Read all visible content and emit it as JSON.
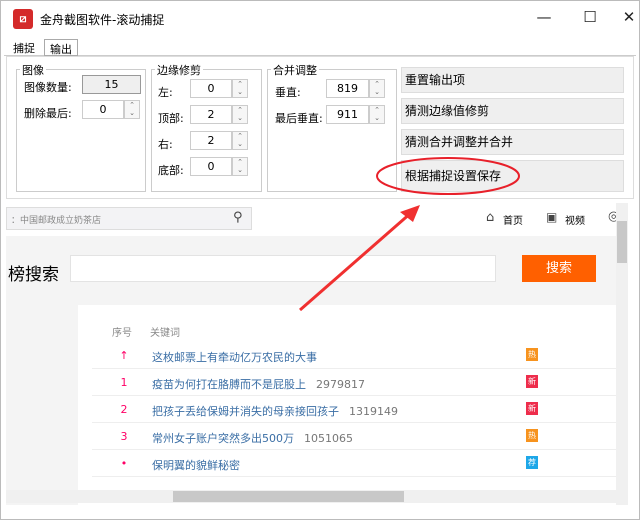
{
  "window": {
    "title": "金舟截图软件-滚动捕捉",
    "app_icon": "ZJ"
  },
  "tabs": [
    {
      "label": "捕捉"
    },
    {
      "label": "输出"
    }
  ],
  "groups": {
    "image": {
      "title": "图像",
      "count_label": "图像数量:",
      "count_value": "15",
      "delete_last_label": "删除最后:",
      "delete_last_value": "0"
    },
    "crop": {
      "title": "边缘修剪",
      "left_label": "左:",
      "left_value": "0",
      "top_label": "顶部:",
      "top_value": "2",
      "right_label": "右:",
      "right_value": "2",
      "bottom_label": "底部:",
      "bottom_value": "0"
    },
    "merge": {
      "title": "合并调整",
      "vertical_label": "垂直:",
      "vertical_value": "819",
      "last_vertical_label": "最后垂直:",
      "last_vertical_value": "911"
    }
  },
  "buttons": [
    "重置输出项",
    "猜测边缘值修剪",
    "猜测合并调整并合并",
    "根据捕捉设置保存"
  ],
  "web": {
    "search_placeholder": "：中国邮政成立奶茶店",
    "nav": [
      {
        "label": "首页",
        "icon": "home-icon"
      },
      {
        "label": "视频",
        "icon": "video-icon"
      }
    ],
    "heading": "榜搜索",
    "search_button": "搜索",
    "accent": "#ff6000",
    "list_headers": {
      "rank": "序号",
      "keyword": "关键词"
    },
    "rows": [
      {
        "rank": "↑",
        "keyword": "这枚邮票上有牵动亿万农民的大事",
        "count": "",
        "badge": "热",
        "badge_color": "#f7931e"
      },
      {
        "rank": "1",
        "keyword": "疫苗为何打在胳膊而不是屁股上",
        "count": "2979817",
        "badge": "新",
        "badge_color": "#ee2d4c"
      },
      {
        "rank": "2",
        "keyword": "把孩子丢给保姆并消失的母亲接回孩子",
        "count": "1319149",
        "badge": "新",
        "badge_color": "#ee2d4c"
      },
      {
        "rank": "3",
        "keyword": "常州女子账户突然多出500万",
        "count": "1051065",
        "badge": "热",
        "badge_color": "#f7931e"
      },
      {
        "rank": "•",
        "keyword": "保明翼的貌鲜秘密",
        "count": "",
        "badge": "荐",
        "badge_color": "#1ea7e8"
      }
    ]
  }
}
